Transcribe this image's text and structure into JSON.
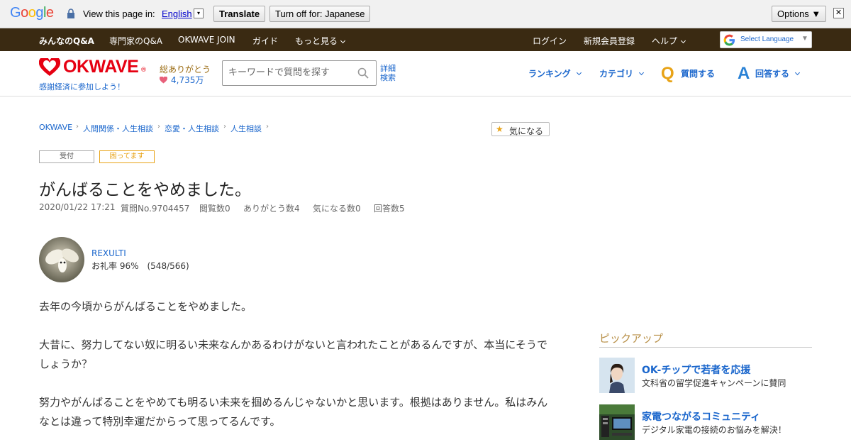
{
  "translate_bar": {
    "logo": "Google",
    "view_text": "View this page in:",
    "language": "English",
    "translate_label": "Translate",
    "turn_off_label": "Turn off for: Japanese",
    "options_label": "Options ▼",
    "close_label": "✕",
    "lang_arrow": "▾"
  },
  "top_nav": {
    "items": [
      "みんなのQ&A",
      "専門家のQ&A",
      "OKWAVE JOIN",
      "ガイド",
      "もっと見る"
    ],
    "right": [
      "ログイン",
      "新規会員登録",
      "ヘルプ"
    ],
    "select_language": "Select Language",
    "select_arrow": "▼"
  },
  "header": {
    "logo_text": "OKWAVE",
    "logo_reg": "®",
    "tagline": "感謝経済に参加しよう！",
    "thanks_label": "総ありがとう",
    "thanks_count": "4,735万",
    "search_placeholder": "キーワードで質問を探す",
    "advanced_line1": "詳細",
    "advanced_line2": "検索",
    "nav": [
      "ランキング",
      "カテゴリ"
    ],
    "ask_icon": "Q",
    "ask_label": "質問する",
    "answer_icon": "A",
    "answer_label": "回答する"
  },
  "breadcrumb": [
    "OKWAVE",
    "人間関係・人生相談",
    "恋愛・人生相談",
    "人生相談"
  ],
  "breadcrumb_sep": "›",
  "kininaru": {
    "icon": "★",
    "label": "気になる"
  },
  "tags": [
    "受付",
    "困ってます"
  ],
  "question": {
    "title": "がんばることをやめました。",
    "meta": [
      "2020/01/22 17:21",
      "質問No.9704457",
      "閲覧数0",
      "ありがとう数4",
      "気になる数0",
      "回答数5"
    ],
    "user": "REXULTI",
    "rate": "お礼率 96%　(548/566)",
    "body": [
      "去年の今頃からがんばることをやめました。",
      "大昔に、努力してない奴に明るい未来なんかあるわけがないと言われたことがあるんですが、本当にそうでしょうか？",
      "努力やがんばることをやめても明るい未来を掴めるんじゃないかと思います。根拠はありません。私はみんなとは違って特別幸運だからって思ってるんです。"
    ]
  },
  "sidebar": {
    "heading": "ピックアップ",
    "items": [
      {
        "title": "OK-チップで若者を応援",
        "sub": "文科省の留学促進キャンペーンに賛同"
      },
      {
        "title": "家電つながるコミュニティ",
        "sub": "デジタル家電の接続のお悩みを解決！"
      }
    ]
  },
  "colors": {
    "brand_red": "#e60012",
    "link_blue": "#1a66cc",
    "nav_brown": "#3a2a12",
    "accent_orange": "#e8a317"
  }
}
